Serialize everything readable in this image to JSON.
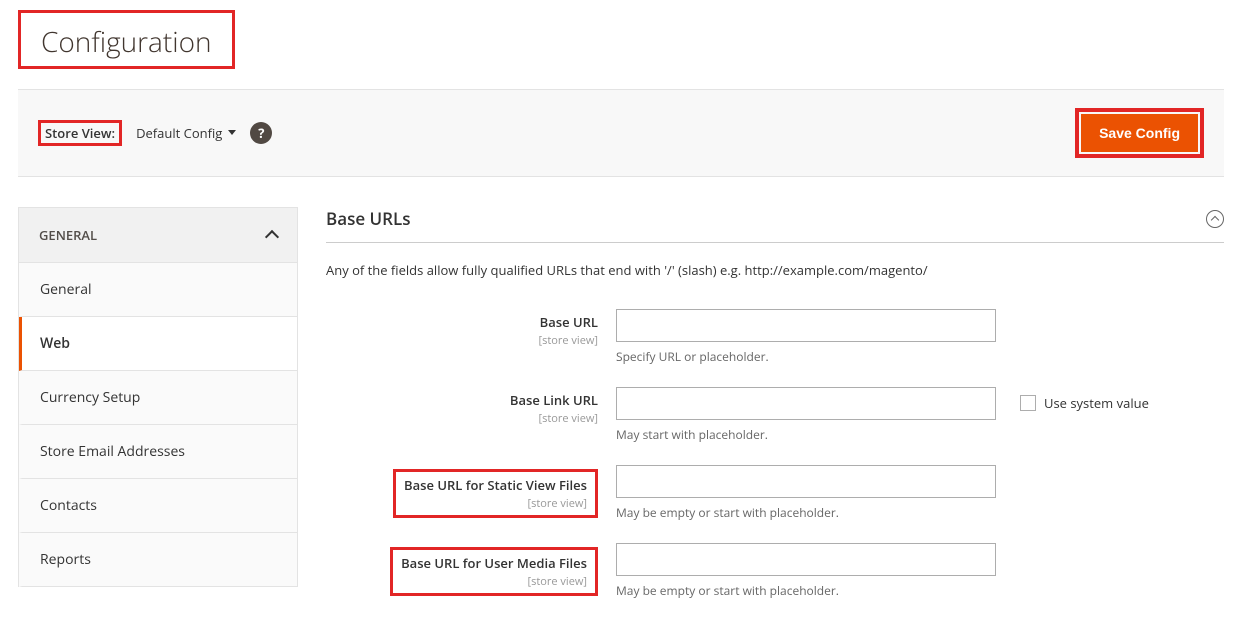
{
  "pageTitle": "Configuration",
  "toolbar": {
    "storeViewLabel": "Store View:",
    "storeViewValue": "Default Config",
    "saveLabel": "Save Config"
  },
  "sidebar": {
    "groupLabel": "GENERAL",
    "items": [
      {
        "label": "General",
        "active": false
      },
      {
        "label": "Web",
        "active": true
      },
      {
        "label": "Currency Setup",
        "active": false
      },
      {
        "label": "Store Email Addresses",
        "active": false
      },
      {
        "label": "Contacts",
        "active": false
      },
      {
        "label": "Reports",
        "active": false
      }
    ]
  },
  "section": {
    "title": "Base URLs",
    "description": "Any of the fields allow fully qualified URLs that end with '/' (slash) e.g. http://example.com/magento/"
  },
  "scopeText": "[store view]",
  "fields": [
    {
      "label": "Base URL",
      "note": "Specify URL or placeholder.",
      "boxed": false,
      "showCheckbox": false,
      "value": ""
    },
    {
      "label": "Base Link URL",
      "note": "May start with placeholder.",
      "boxed": false,
      "showCheckbox": true,
      "checkboxLabel": "Use system value",
      "value": ""
    },
    {
      "label": "Base URL for Static View Files",
      "note": "May be empty or start with placeholder.",
      "boxed": true,
      "showCheckbox": false,
      "value": ""
    },
    {
      "label": "Base URL for User Media Files",
      "note": "May be empty or start with placeholder.",
      "boxed": true,
      "showCheckbox": false,
      "value": ""
    }
  ]
}
